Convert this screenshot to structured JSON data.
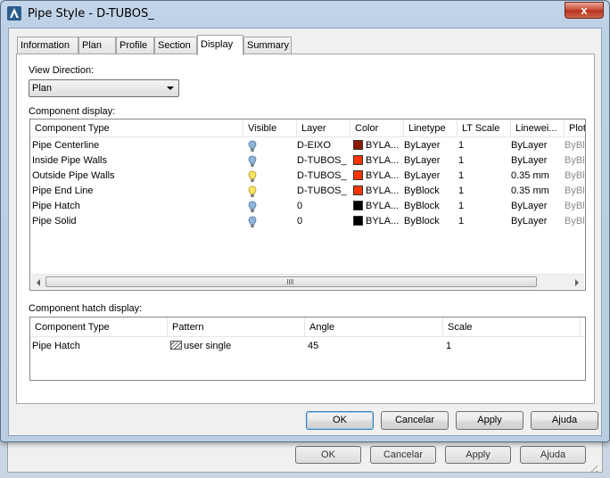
{
  "window": {
    "title": "Pipe Style - D-TUBOS_",
    "close_label": "x"
  },
  "tabs": [
    {
      "label": "Information"
    },
    {
      "label": "Plan"
    },
    {
      "label": "Profile"
    },
    {
      "label": "Section"
    },
    {
      "label": "Display",
      "active": true
    },
    {
      "label": "Summary"
    }
  ],
  "view_direction": {
    "label": "View Direction:",
    "selected": "Plan"
  },
  "component_display": {
    "label": "Component display:",
    "columns": [
      "Component Type",
      "Visible",
      "Layer",
      "Color",
      "Linetype",
      "LT Scale",
      "Linewei...",
      "Plot"
    ],
    "rows": [
      {
        "type": "Pipe Centerline",
        "visible": "on",
        "layer": "D-EIXO",
        "color_hex": "#8b1a00",
        "color": "BYLA...",
        "linetype": "ByLayer",
        "lt_scale": "1",
        "lineweight": "ByLayer",
        "plot": "ByBl"
      },
      {
        "type": "Inside Pipe Walls",
        "visible": "on",
        "layer": "D-TUBOS_",
        "color_hex": "#ff3300",
        "color": "BYLA...",
        "linetype": "ByLayer",
        "lt_scale": "1",
        "lineweight": "ByLayer",
        "plot": "ByBl"
      },
      {
        "type": "Outside Pipe Walls",
        "visible": "lit",
        "layer": "D-TUBOS_",
        "color_hex": "#ff3300",
        "color": "BYLA...",
        "linetype": "ByLayer",
        "lt_scale": "1",
        "lineweight": "0.35 mm",
        "plot": "ByBl"
      },
      {
        "type": "Pipe End Line",
        "visible": "lit",
        "layer": "D-TUBOS_",
        "color_hex": "#ff3300",
        "color": "BYLA...",
        "linetype": "ByBlock",
        "lt_scale": "1",
        "lineweight": "0.35 mm",
        "plot": "ByBl"
      },
      {
        "type": "Pipe Hatch",
        "visible": "on",
        "layer": "0",
        "color_hex": "#000000",
        "color": "BYLA...",
        "linetype": "ByBlock",
        "lt_scale": "1",
        "lineweight": "ByLayer",
        "plot": "ByBl"
      },
      {
        "type": "Pipe Solid",
        "visible": "on",
        "layer": "0",
        "color_hex": "#000000",
        "color": "BYLA...",
        "linetype": "ByBlock",
        "lt_scale": "1",
        "lineweight": "ByLayer",
        "plot": "ByBl"
      }
    ],
    "scroll_grip": "III"
  },
  "hatch_display": {
    "label": "Component hatch display:",
    "columns": [
      "Component Type",
      "Pattern",
      "Angle",
      "Scale"
    ],
    "rows": [
      {
        "type": "Pipe Hatch",
        "pattern": "user single",
        "angle": "45",
        "scale": "1"
      }
    ]
  },
  "buttons": {
    "ok": "OK",
    "cancel": "Cancelar",
    "apply": "Apply",
    "help": "Ajuda"
  },
  "background_buttons": {
    "ok": "OK",
    "cancel": "Cancelar",
    "apply": "Apply",
    "help": "Ajuda"
  },
  "colors": {
    "bulb_on": "#5f8fbf",
    "bulb_lit": "#f4e04a",
    "default_button_border": "#3c7fb1"
  },
  "icons": {
    "app": "autocad-a-icon",
    "visible_on": "lightbulb-on-icon",
    "visible_lit": "lightbulb-lit-icon",
    "hatch_pattern": "hatch-pattern-icon"
  }
}
